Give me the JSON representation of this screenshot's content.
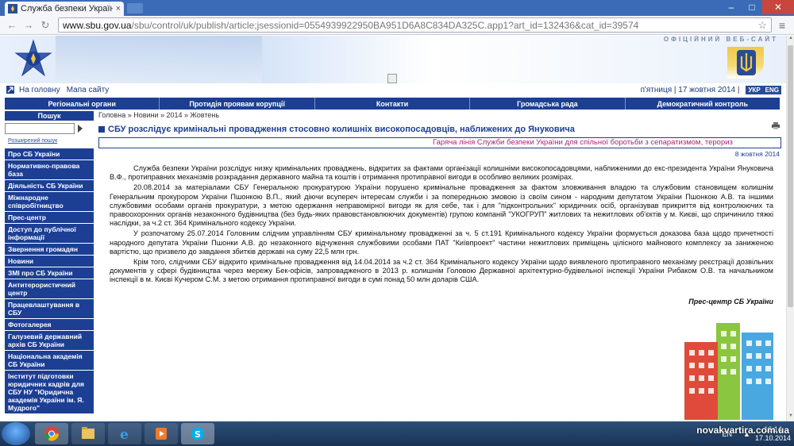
{
  "browser": {
    "tab_title": "Служба безпеки України",
    "tab_close": "×",
    "url_domain": "www.sbu.gov.ua",
    "url_path": "/sbu/control/uk/publish/article;jsessionid=0554939922950BA951D6A8C834DA325C.app1?art_id=132436&cat_id=39574",
    "win_minimize": "–",
    "win_maximize": "□",
    "win_close": "✕"
  },
  "header": {
    "official_site": "ОФІЦІЙНИЙ ВЕБ-САЙТ"
  },
  "utility": {
    "home_link": "На головну",
    "sitemap_link": "Мапа сайту",
    "date": "п'ятниця | 17 жовтня 2014 |",
    "lang_ukr": "УКР",
    "lang_eng": "ENG"
  },
  "mainnav": {
    "items": [
      "Регіональні органи",
      "Протидія проявам корупції",
      "Контакти",
      "Громадська рада",
      "Демократичний контроль"
    ]
  },
  "sidebar": {
    "search_title": "Пошук",
    "advanced_search": "Розширений пошук",
    "menu": [
      "Про СБ України",
      "Нормативно-правова база",
      "Діяльність СБ України",
      "Міжнародне співробітництво",
      "Прес-центр",
      "Доступ до публічної інформації",
      "Звернення громадян",
      "Новини",
      "ЗМІ про СБ України",
      "Антитерористичний центр",
      "Працевлаштування в СБУ",
      "Фотогалерея",
      "Галузевий державний архів СБ України",
      "Національна академія СБ України",
      "Інститут підготовки юридичних кадрів для СБУ НУ \"Юридична академія України ім. Я. Мудрого\""
    ]
  },
  "content": {
    "breadcrumb": "Головна » Новини » 2014 » Жовтень",
    "title": "СБУ розслідує кримінальні провадження стосовно колишніх високопосадовців, наближених до Януковича",
    "ticker": "Гаряча лінія Служби безпеки України для спільної боротьби з сепаратизмом, терориз",
    "pubdate": "8 жовтня 2014",
    "paragraphs": [
      "Служба безпеки України розслідує низку кримінальних проваджень, відкритих за фактами організації колишніми високопосадовцями, наближеними до екс-президента України Януковича В.Ф., протиправних механізмів розкрадання державного майна та коштів і отримання протиправної вигоди в особливо великих розмірах.",
      "20.08.2014 за матеріалами СБУ Генеральною прокуратурою України порушено кримінальне провадження за фактом зловживання владою та службовим становищем колишнім Генеральним прокурором України Пшонкою В.П., який діючи всупереч інтересам служби і за попередньою змовою із своїм сином - народним депутатом України Пшонкою А.В. та іншими службовими особами органів прокуратури, з метою одержання неправомірної вигоди як для себе, так і для \"підконтрольних\" юридичних осіб, організував прикриття від контролюючих та правоохоронних органів незаконного будівництва (без будь-яких правовстановлюючих документів) групою компаній \"УКОГРУП\" житлових та нежитлових об'єктів у м. Києві, що спричинило тяжкі наслідки, за ч.2 ст. 364 Кримінального кодексу України.",
      "У розпочатому 25.07.2014 Головним слідчим управлінням СБУ кримінальному провадженні за ч. 5 ст.191 Кримінального кодексу України формується доказова база щодо причетності народного депутата України Пшонки А.В. до незаконного відчуження службовими особами ПАТ \"Київпроект\" частини нежитлових приміщень цілісного майнового комплексу за заниженою вартістю, що призвело до завдання збитків державі на суму 22,5 млн грн.",
      "Крім того, слідчими СБУ відкрито кримінальне провадження від 14.04.2014 за ч.2 ст. 364 Кримінального кодексу України щодо виявленого протиправного механізму реєстрації дозвільних документів у сфері будівництва через мережу Бек-офісів, запровадженого в 2013 р. колишнім Головою Державної архітектурно-будівельної інспекції України Рибаком О.В. та начальником інспекції в м. Києві Кучером С.М. з метою отримання протиправної вигоди в сумі понад 50 млн доларів США."
    ],
    "signature": "Прес-центр СБ України"
  },
  "taskbar": {
    "lang": "EN",
    "time": "16:14",
    "date": "17.10.2014",
    "watermark": "novakvartira.com.ua"
  },
  "colors": {
    "nav_blue": "#1c3f94",
    "ticker_magenta": "#b02080",
    "tab_strip": "#3b6bb6"
  }
}
